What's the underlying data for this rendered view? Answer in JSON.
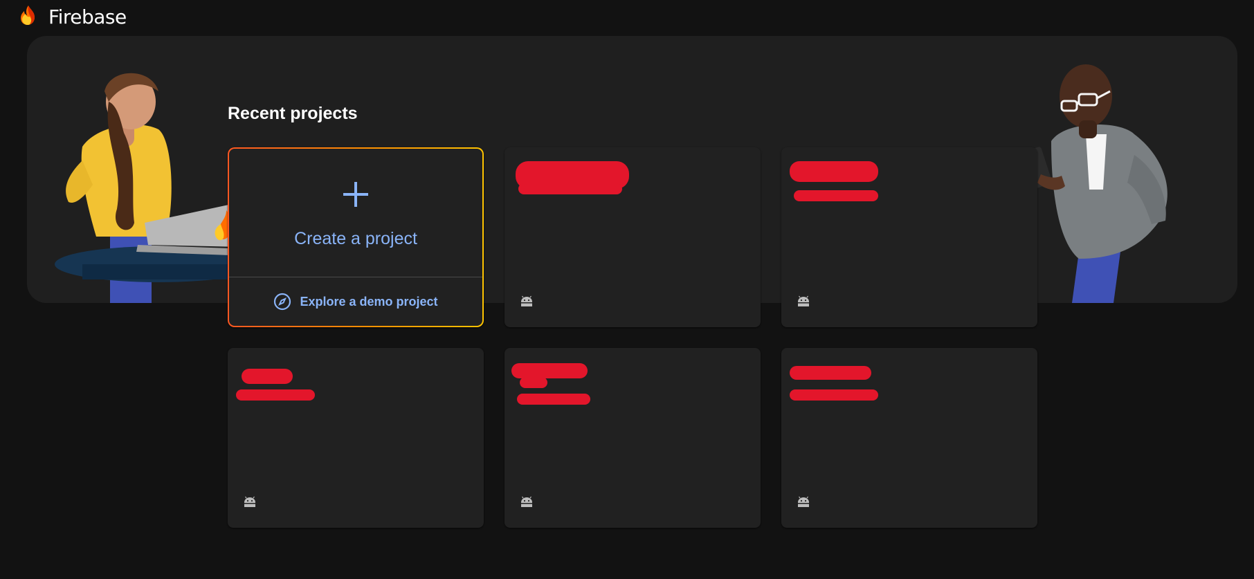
{
  "header": {
    "brand": "Firebase",
    "logo_icon": "firebase-flame-icon"
  },
  "main": {
    "section_title": "Recent projects"
  },
  "create_card": {
    "label": "Create a project",
    "demo_label": "Explore a demo project",
    "plus_icon": "plus-icon",
    "demo_icon": "compass-icon"
  },
  "projects": [
    {
      "name": "",
      "id": "",
      "platform_icon": "android-icon"
    },
    {
      "name": "",
      "id": "",
      "platform_icon": "android-icon"
    },
    {
      "name": "",
      "id": "",
      "platform_icon": "android-icon"
    },
    {
      "name": "",
      "id": "",
      "platform_icon": "android-icon"
    },
    {
      "name": "",
      "id": "",
      "platform_icon": "android-icon"
    }
  ],
  "colors": {
    "background": "#121212",
    "panel": "#1f1f1f",
    "card": "#212121",
    "accent_blue": "#8ab4f8",
    "redaction": "#e3162b",
    "gradient_start": "#ff5722",
    "gradient_end": "#ffc400"
  }
}
